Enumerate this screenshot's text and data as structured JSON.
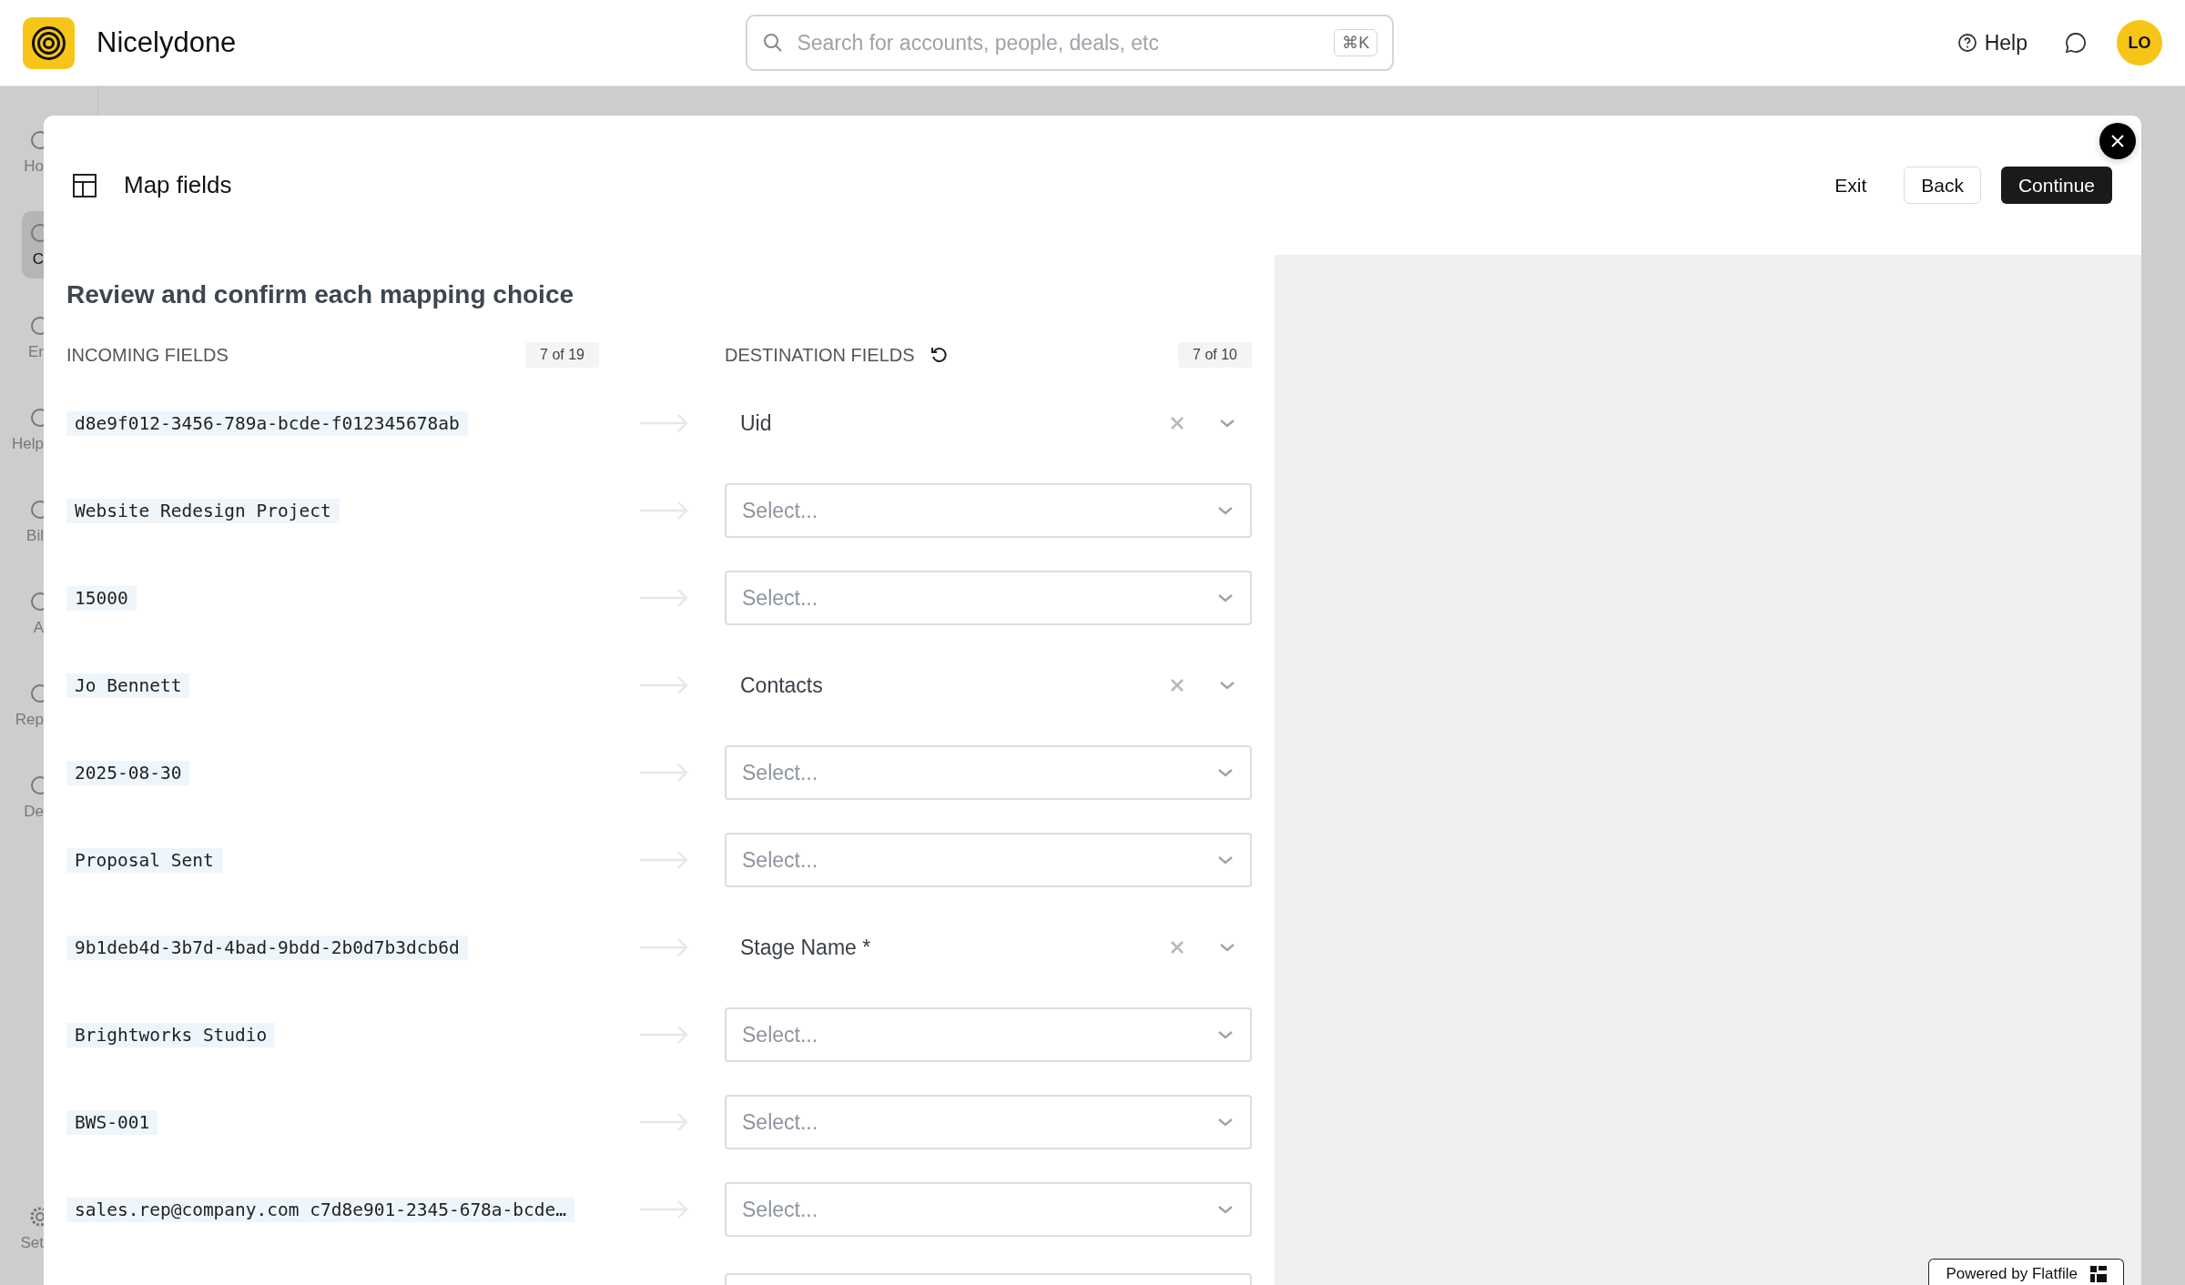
{
  "topbar": {
    "app_name": "Nicelydone",
    "search": {
      "placeholder": "Search for accounts, people, deals, etc",
      "shortcut": "⌘K"
    },
    "help": "Help",
    "avatar": "LO"
  },
  "sidebar": {
    "items": [
      {
        "label": "Ho",
        "selected": false
      },
      {
        "label": "C",
        "selected": true
      },
      {
        "label": "Er",
        "selected": false
      },
      {
        "label": "Help",
        "selected": false
      },
      {
        "label": "Bil",
        "selected": false
      },
      {
        "label": "A",
        "selected": false
      },
      {
        "label": "Rep",
        "selected": false
      },
      {
        "label": "De",
        "selected": false
      }
    ],
    "bottom_item": {
      "label": "Set"
    }
  },
  "modal": {
    "title": "Map fields",
    "actions": [
      "Exit",
      "Back",
      "Continue"
    ],
    "heading": "Review and confirm each mapping choice",
    "incoming_header": {
      "label": "INCOMING FIELDS",
      "count": "7 of 19"
    },
    "destination_header": {
      "label": "DESTINATION FIELDS",
      "count": "7 of 10"
    },
    "rows": [
      {
        "incoming": "d8e9f012-3456-789a-bcde-f012345678ab",
        "kind": "mapped",
        "destination": "Uid"
      },
      {
        "incoming": "Website Redesign Project",
        "kind": "select",
        "placeholder": "Select..."
      },
      {
        "incoming": "15000",
        "kind": "select",
        "placeholder": "Select..."
      },
      {
        "incoming": "Jo Bennett",
        "kind": "mapped",
        "destination": "Contacts"
      },
      {
        "incoming": "2025-08-30",
        "kind": "select",
        "placeholder": "Select..."
      },
      {
        "incoming": "Proposal Sent",
        "kind": "select",
        "placeholder": "Select..."
      },
      {
        "incoming": "9b1deb4d-3b7d-4bad-9bdd-2b0d7b3dcb6d",
        "kind": "mapped",
        "destination": "Stage Name *"
      },
      {
        "incoming": "Brightworks Studio",
        "kind": "select",
        "placeholder": "Select..."
      },
      {
        "incoming": "BWS-001",
        "kind": "select",
        "placeholder": "Select..."
      },
      {
        "incoming": "sales.rep@company.com c7d8e901-2345-678a-bcde…",
        "kind": "select",
        "placeholder": "Select..."
      },
      {
        "kind": "partial"
      }
    ],
    "powered_by": "Powered by Flatfile"
  }
}
